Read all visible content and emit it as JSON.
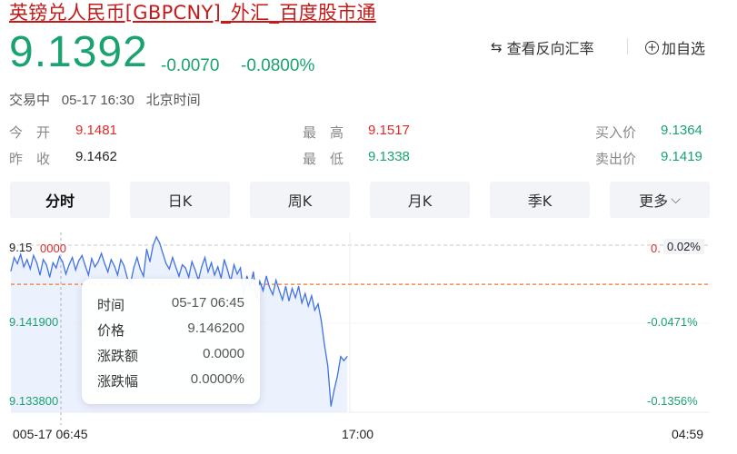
{
  "header": {
    "title": "英镑兑人民币[GBPCNY]_外汇_百度股市通",
    "price": "9.1392",
    "change": "-0.0070",
    "change_pct": "-0.0800%",
    "reverse_rate_label": "查看反向汇率",
    "add_watch_label": "加自选"
  },
  "status": {
    "state": "交易中",
    "datetime": "05-17 16:30",
    "timezone": "北京时间"
  },
  "stats": {
    "open_label": "今　开",
    "open_value": "9.1481",
    "prev_close_label": "昨　收",
    "prev_close_value": "9.1462",
    "high_label": "最　高",
    "high_value": "9.1517",
    "low_label": "最　低",
    "low_value": "9.1338",
    "bid_label": "买入价",
    "bid_value": "9.1364",
    "ask_label": "卖出价",
    "ask_value": "9.1419"
  },
  "tabs": [
    {
      "label": "分时",
      "active": true
    },
    {
      "label": "日K",
      "active": false
    },
    {
      "label": "周K",
      "active": false
    },
    {
      "label": "月K",
      "active": false
    },
    {
      "label": "季K",
      "active": false
    },
    {
      "label": "更多",
      "active": false
    }
  ],
  "chart": {
    "y_left_labels": [
      "9.15",
      "9.141900",
      "9.133800"
    ],
    "y_left_top_overlay": "0000",
    "y_right_labels": [
      "0.02%",
      "-0.0471%",
      "-0.1356%"
    ],
    "y_right_top_overlay": "0.",
    "x_labels": [
      "005-17 06:45",
      "17:00",
      "04:59"
    ],
    "colors": {
      "line": "#3f72e6",
      "fill": "#e6ecfd",
      "ref": "#ef7a2e",
      "down": "#1aa36f",
      "up": "#e02a2a"
    }
  },
  "chart_data": {
    "type": "line",
    "title": "",
    "xlabel": "",
    "ylabel": "",
    "ylim": [
      9.1338,
      9.15
    ],
    "reference_value": 9.1462,
    "x_ticks": [
      "06:45",
      "17:00",
      "04:59"
    ],
    "series": [
      {
        "values": [
          9.1475,
          9.1488,
          9.1482,
          9.1491,
          9.1479,
          9.1486,
          9.1477,
          9.149,
          9.1483,
          9.1471,
          9.1486,
          9.1481,
          9.1469,
          9.1483,
          9.1478,
          9.1489,
          9.1484,
          9.1472,
          9.1481,
          9.1488,
          9.1476,
          9.1485,
          9.149,
          9.148,
          9.1471,
          9.1487,
          9.1479,
          9.1484,
          9.1492,
          9.1482,
          9.1474,
          9.1486,
          9.148,
          9.1471,
          9.1486,
          9.148,
          9.1468,
          9.1463,
          9.1478,
          9.1488,
          9.1477,
          9.147,
          9.1496,
          9.1484,
          9.15,
          9.1508,
          9.1502,
          9.1492,
          9.1482,
          9.1477,
          9.1488,
          9.1479,
          9.147,
          9.1481,
          9.1478,
          9.1469,
          9.1484,
          9.1476,
          9.1466,
          9.1479,
          9.1488,
          9.1474,
          9.1483,
          9.1471,
          9.1479,
          9.1468,
          9.1486,
          9.1476,
          9.1465,
          9.1481,
          9.1472,
          9.1478,
          9.1452,
          9.147,
          9.146,
          9.1474,
          9.1448,
          9.1465,
          9.1456,
          9.147,
          9.1459,
          9.1452,
          9.1466,
          9.1456,
          9.1447,
          9.146,
          9.1446,
          9.1458,
          9.1449,
          9.146,
          9.1444,
          9.1453,
          9.1441,
          9.1451,
          9.1437,
          9.1443,
          9.1427,
          9.1403,
          9.1383,
          9.1344,
          9.136,
          9.1373,
          9.1392,
          9.1388,
          9.1392
        ]
      }
    ],
    "tooltip": {
      "time_label": "时间",
      "time_value": "05-17 06:45",
      "price_label": "价格",
      "price_value": "9.146200",
      "change_label": "涨跌额",
      "change_value": "0.0000",
      "pct_label": "涨跌幅",
      "pct_value": "0.0000%"
    }
  }
}
